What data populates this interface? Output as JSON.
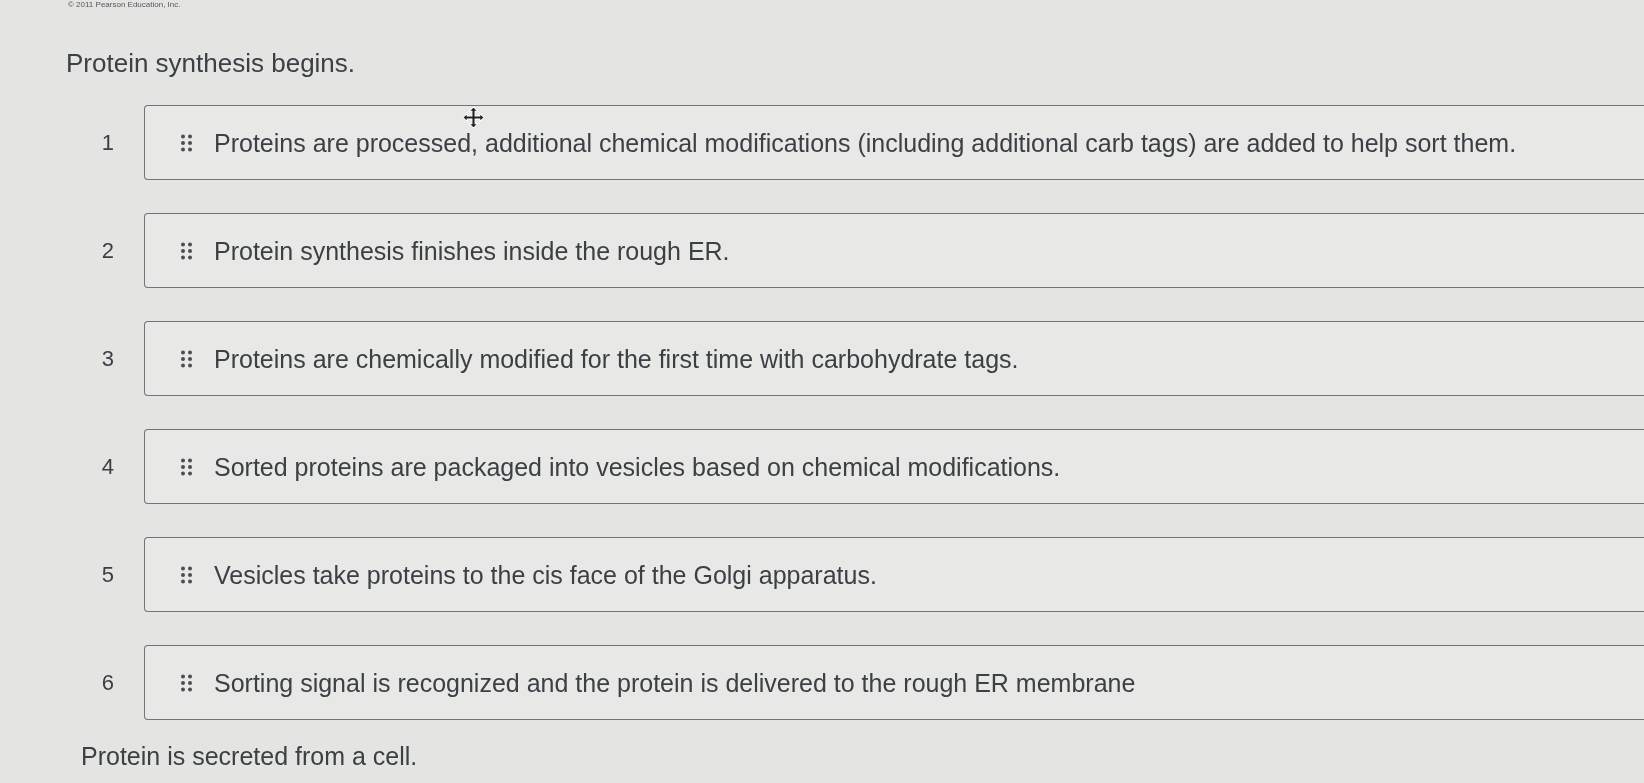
{
  "copyright": "© 2011 Pearson Education, Inc.",
  "start_label": "Protein synthesis begins.",
  "items": [
    {
      "number": "1",
      "text": "Proteins are processed, additional chemical modifications (including additional carb tags) are added to help sort them.",
      "hovered": true
    },
    {
      "number": "2",
      "text": "Protein synthesis finishes inside the rough ER.",
      "hovered": false
    },
    {
      "number": "3",
      "text": "Proteins are chemically modified for the first time with carbohydrate tags.",
      "hovered": false
    },
    {
      "number": "4",
      "text": "Sorted proteins are packaged into vesicles based on chemical modifications.",
      "hovered": false
    },
    {
      "number": "5",
      "text": "Vesicles take proteins to the cis face of the Golgi apparatus.",
      "hovered": false
    },
    {
      "number": "6",
      "text": "Sorting signal is recognized and the protein is delivered to the rough ER membrane",
      "hovered": false
    }
  ],
  "end_label": "Protein is secreted from a cell."
}
